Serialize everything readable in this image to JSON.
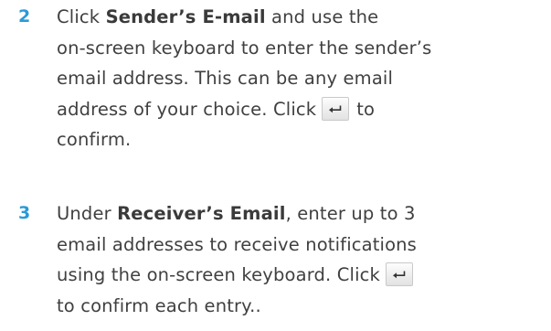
{
  "steps": [
    {
      "number": "2",
      "lines": {
        "l1_pre": "Click ",
        "l1_bold": "Sender’s E-mail",
        "l1_post": " and use the",
        "l2": "on-screen keyboard to enter the sender’s",
        "l3": "email address. This can be any email",
        "l4_pre": "address of your choice. Click",
        "l4_post": "to",
        "l5": "confirm."
      },
      "icon": "enter-key-icon"
    },
    {
      "number": "3",
      "lines": {
        "l1_pre": "Under ",
        "l1_bold": "Receiver’s Email",
        "l1_post": ", enter up to 3",
        "l2": "email addresses to receive notifications",
        "l3_pre": "using the on-screen keyboard. Click",
        "l4": "to confirm each entry.."
      },
      "icon": "enter-key-icon"
    }
  ],
  "colors": {
    "step_number": "#2a9ad6",
    "body_text": "#404040"
  }
}
